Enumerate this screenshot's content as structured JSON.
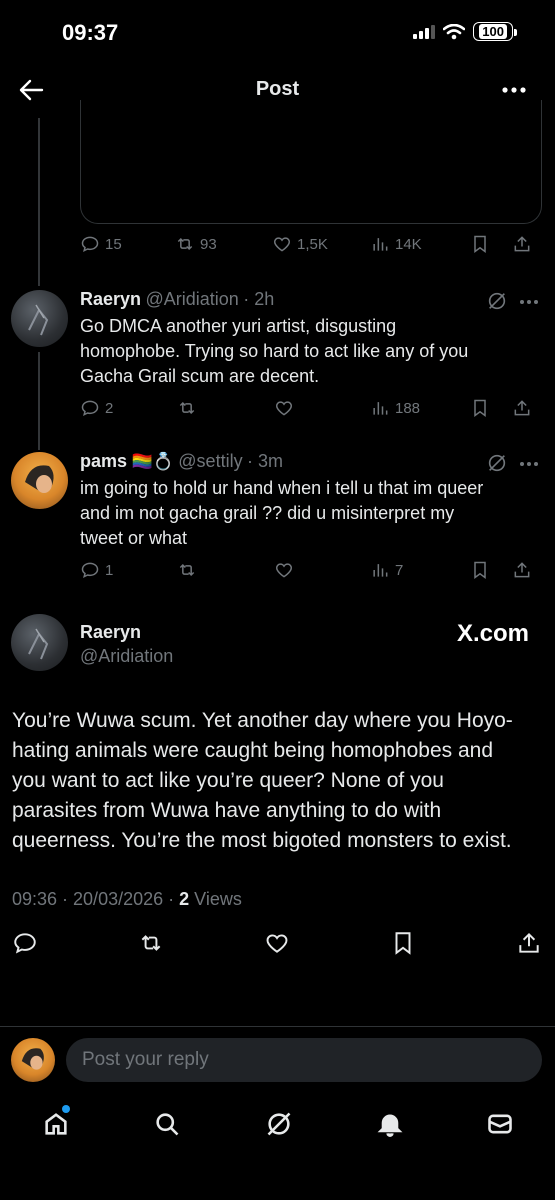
{
  "status_bar": {
    "time": "09:37",
    "battery": "100"
  },
  "header": {
    "title": "Post"
  },
  "top_post_stats": {
    "replies": "15",
    "reposts": "93",
    "likes": "1,5K",
    "views": "14K"
  },
  "replies": [
    {
      "name": "Raeryn",
      "handle": "@Aridiation",
      "time": "· 2h",
      "text": "Go DMCA another yuri artist, disgusting homophobe. Trying so hard to act like any of you Gacha Grail scum are decent.",
      "text_lines": [
        "Go DMCA another yuri artist, disgusting",
        "homophobe. Trying so hard to act like any of you",
        "Gacha Grail scum are decent."
      ],
      "replies": "2",
      "views": "188"
    },
    {
      "name": "pams",
      "emoji": "🏳️‍🌈💍",
      "handle": "@settily",
      "time": "· 3m",
      "text_lines": [
        "im going to hold ur hand when i tell u that im queer",
        "and im not gacha grail ?? did u misinterpret my",
        "tweet or what"
      ],
      "replies": "1",
      "views": "7"
    }
  ],
  "main_post": {
    "name": "Raeryn",
    "handle": "@Aridiation",
    "watermark": "X.com",
    "text_lines": [
      "You’re Wuwa scum. Yet another day where you Hoyo-",
      "hating animals were caught being homophobes and",
      "you want to act like you’re queer? None of you",
      "parasites from Wuwa have anything to do with",
      "queerness. You’re the most bigoted monsters to exist."
    ],
    "timestamp": "09:36 · 20/03/2026 · ",
    "views_count": "2",
    "views_label": " Views"
  },
  "reply_bar": {
    "placeholder": "Post your reply"
  },
  "colors": {
    "background": "#000000",
    "text": "#e7e9ea",
    "muted": "#71767b",
    "accent": "#1d9bf0"
  }
}
